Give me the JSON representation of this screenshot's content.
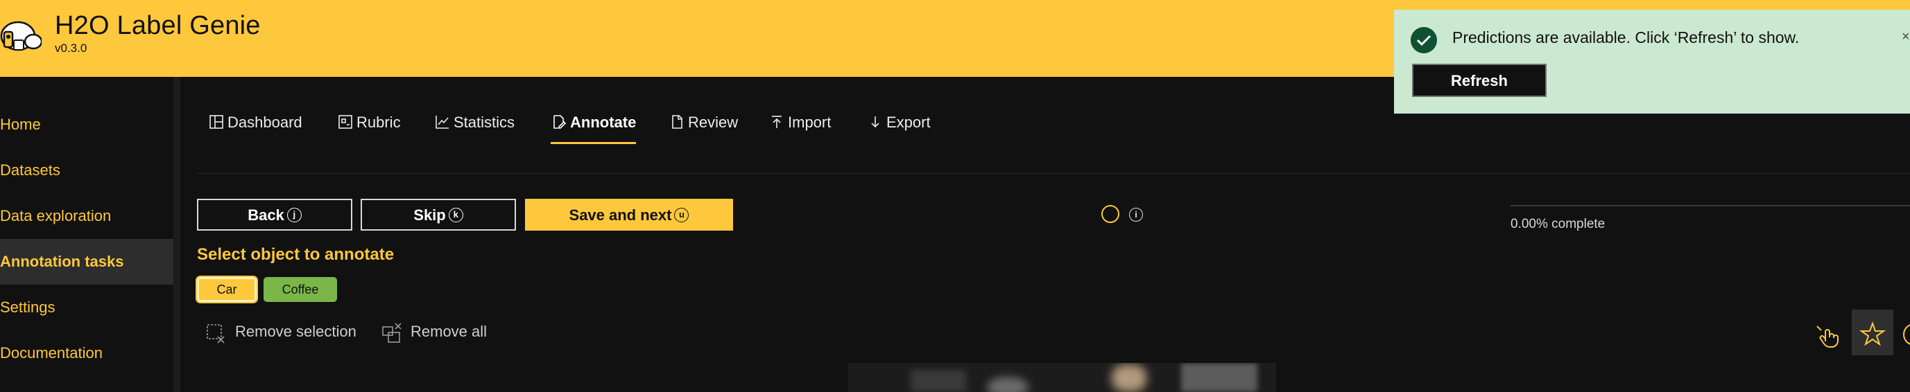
{
  "app": {
    "title": "H2O Label Genie",
    "version": "v0.3.0"
  },
  "sidebar": {
    "items": [
      {
        "label": "Home",
        "active": false
      },
      {
        "label": "Datasets",
        "active": false
      },
      {
        "label": "Data exploration",
        "active": false
      },
      {
        "label": "Annotation tasks",
        "active": true
      },
      {
        "label": "Settings",
        "active": false
      },
      {
        "label": "Documentation",
        "active": false
      }
    ]
  },
  "tabs": [
    {
      "label": "Dashboard",
      "icon": "dashboard-icon",
      "active": false
    },
    {
      "label": "Rubric",
      "icon": "rubric-icon",
      "active": false
    },
    {
      "label": "Statistics",
      "icon": "chart-line-icon",
      "active": false
    },
    {
      "label": "Annotate",
      "icon": "annotate-icon",
      "active": true
    },
    {
      "label": "Review",
      "icon": "review-icon",
      "active": false
    },
    {
      "label": "Import",
      "icon": "upload-icon",
      "active": false
    },
    {
      "label": "Export",
      "icon": "download-icon",
      "active": false
    }
  ],
  "actions": {
    "back_label": "Back",
    "back_key": "j",
    "skip_label": "Skip",
    "skip_key": "k",
    "save_label": "Save and next",
    "save_key": "u"
  },
  "info": {
    "glyph": "i"
  },
  "progress": {
    "fraction": 0.0,
    "text": "0.00% complete"
  },
  "annotate": {
    "title": "Select object to annotate",
    "classes": [
      {
        "label": "Car",
        "color": "#fec83c",
        "selected": true
      },
      {
        "label": "Coffee",
        "color": "#7ab648",
        "selected": false
      }
    ],
    "remove_selection_label": "Remove selection",
    "remove_all_label": "Remove all",
    "modes": [
      {
        "icon": "pointer-hand-icon",
        "active": false
      },
      {
        "icon": "star-icon",
        "active": true
      },
      {
        "icon": "circle-icon",
        "active": false
      }
    ]
  },
  "notification": {
    "message": "Predictions are available. Click ‘Refresh’ to show.",
    "button_label": "Refresh",
    "close_glyph": "×"
  },
  "colors": {
    "accent": "#fec83c",
    "background": "#111111",
    "success_bg": "#cbe8d0",
    "success_icon": "#0f5132"
  }
}
